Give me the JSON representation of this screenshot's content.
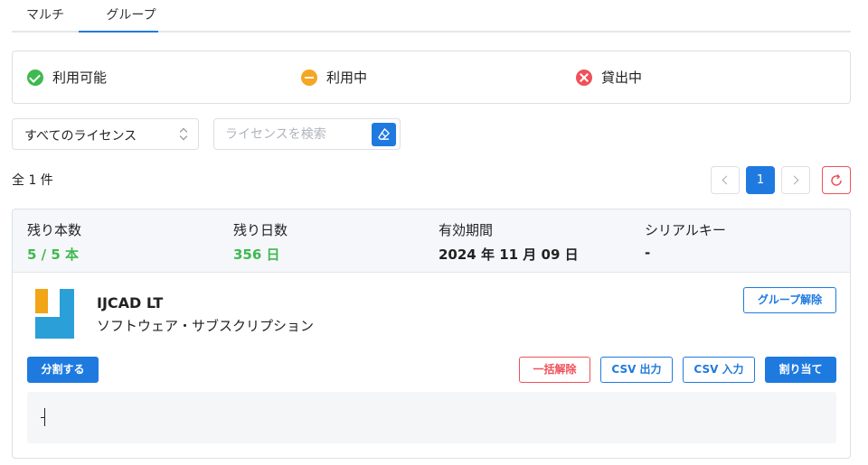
{
  "tabs": [
    {
      "label": "マルチ"
    },
    {
      "label": "グループ"
    }
  ],
  "legend": [
    {
      "label": "利用可能",
      "icon": "check-circle-icon",
      "color": "#3fb950"
    },
    {
      "label": "利用中",
      "icon": "minus-circle-icon",
      "color": "#f5a623"
    },
    {
      "label": "貸出中",
      "icon": "x-circle-icon",
      "color": "#f0505a"
    }
  ],
  "filter": {
    "selected": "すべてのライセンス"
  },
  "search": {
    "placeholder": "ライセンスを検索"
  },
  "count": "全 1 件",
  "pagination": {
    "current": "1"
  },
  "card": {
    "stats": [
      {
        "label": "残り本数",
        "value": "5 / 5 本"
      },
      {
        "label": "残り日数",
        "value": "356 日"
      },
      {
        "label": "有効期間",
        "value": "2024 年 11 月 09 日"
      },
      {
        "label": "シリアルキー",
        "value": "-"
      }
    ],
    "product": {
      "name": "IJCAD LT",
      "type": "ソフトウェア・サブスクリプション"
    },
    "buttons": {
      "ungroup": "グループ解除",
      "split": "分割する",
      "bulk_release": "一括解除",
      "csv_export": "CSV 出力",
      "csv_import": "CSV 入力",
      "assign": "割り当て"
    }
  },
  "colors": {
    "accent": "#1f7ae0",
    "available": "#3fb950",
    "danger": "#f0505a",
    "in_use": "#f5a623"
  }
}
